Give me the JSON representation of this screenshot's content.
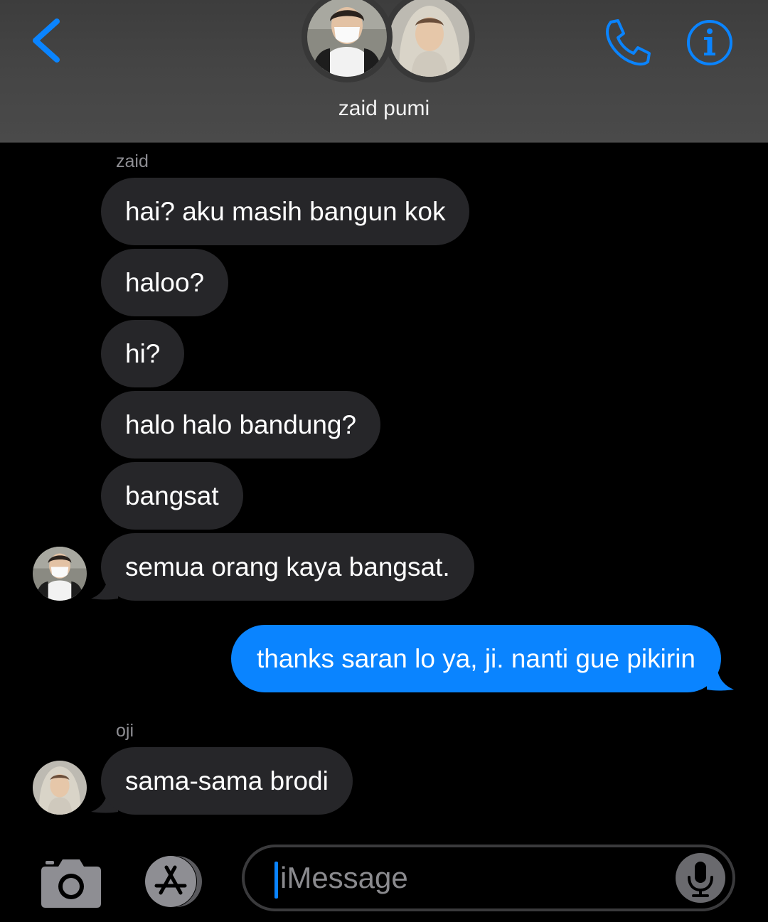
{
  "header": {
    "title": "zaid pumi",
    "icons": {
      "back": "chevron-left-icon",
      "call": "phone-icon",
      "info": "info-icon"
    }
  },
  "colors": {
    "accent": "#0a84ff",
    "incoming_bubble": "#262629",
    "outgoing_bubble": "#0a84ff",
    "sender_name": "#8e8e93",
    "header_bg": "#454545"
  },
  "messages": [
    {
      "sender_label": "zaid",
      "text": "hai? aku masih bangun kok",
      "direction": "in"
    },
    {
      "text": "haloo?",
      "direction": "in"
    },
    {
      "text": "hi?",
      "direction": "in"
    },
    {
      "text": "halo halo bandung?",
      "direction": "in"
    },
    {
      "text": "bangsat",
      "direction": "in"
    },
    {
      "text": "semua orang kaya bangsat.",
      "direction": "in",
      "avatar": "zaid"
    },
    {
      "text": "thanks saran lo ya, ji. nanti gue pikirin",
      "direction": "out"
    },
    {
      "sender_label": "oji",
      "text": "sama-sama brodi",
      "direction": "in",
      "avatar": "oji"
    }
  ],
  "input_bar": {
    "placeholder": "iMessage",
    "value": "",
    "icons": {
      "camera": "camera-icon",
      "apps": "app-store-icon",
      "mic": "microphone-icon"
    }
  }
}
